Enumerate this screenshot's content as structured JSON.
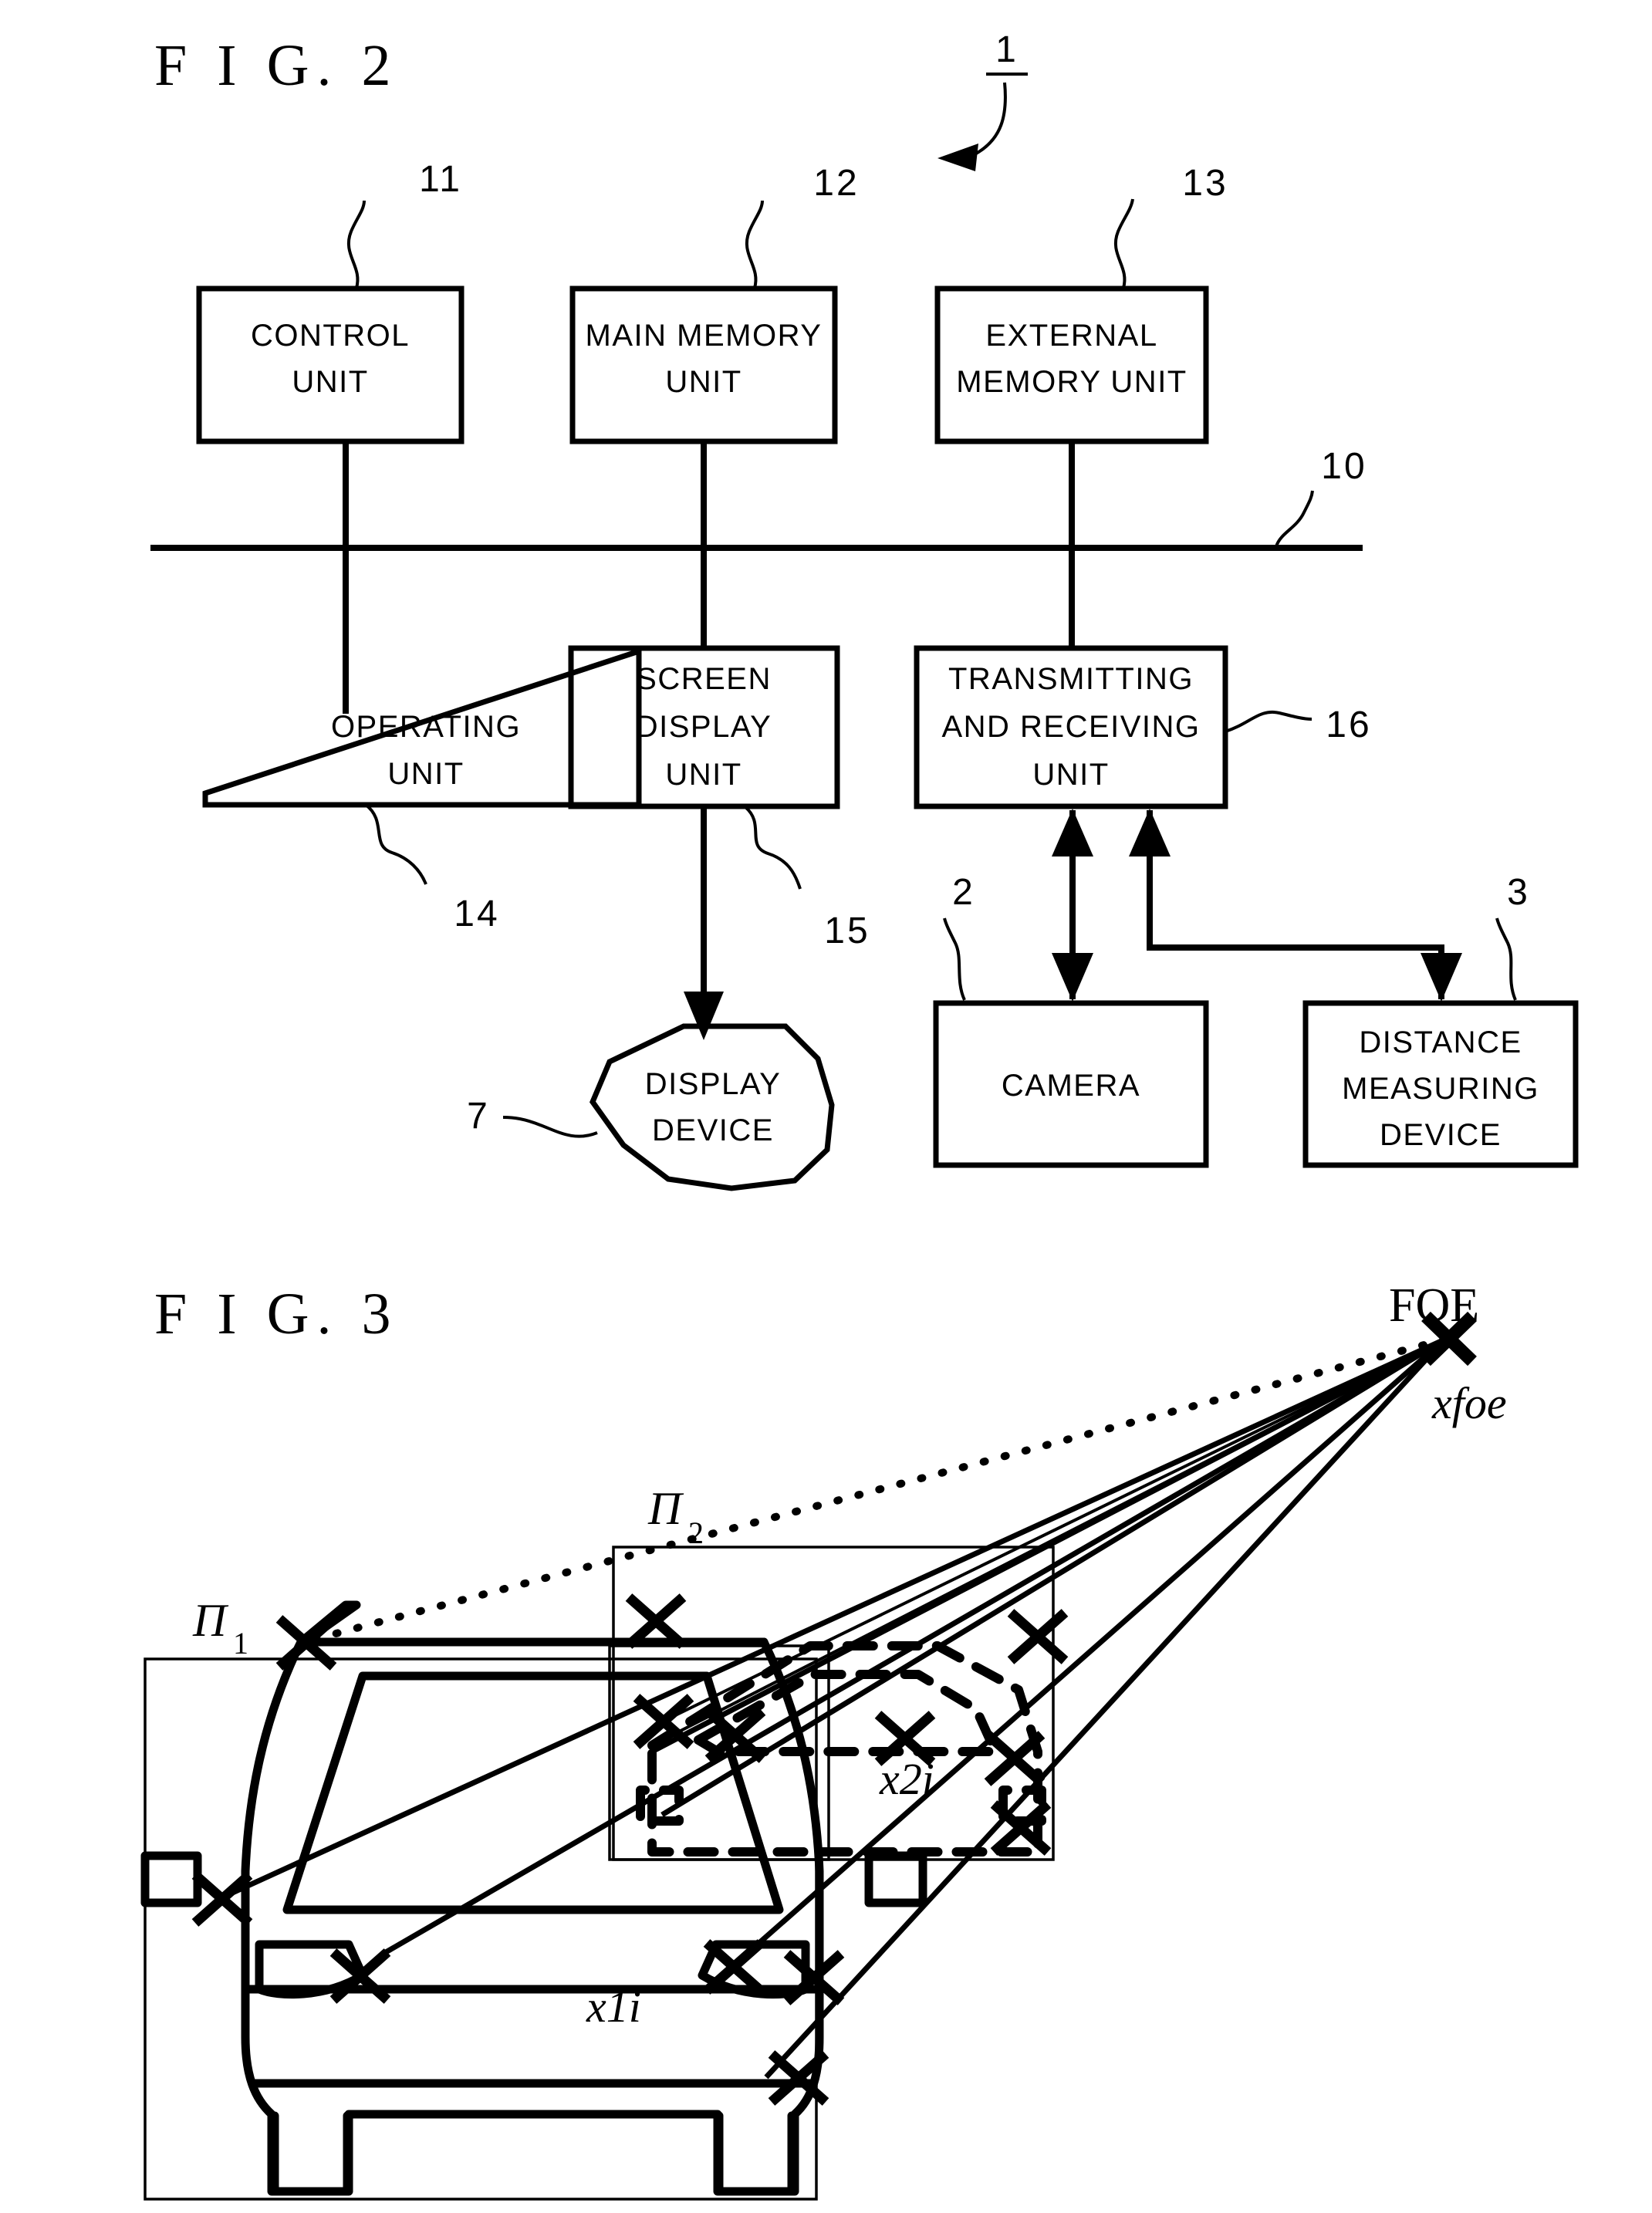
{
  "figures": [
    {
      "title": "F I G. 2",
      "system_ref": "1",
      "bus_ref": "10",
      "blocks": [
        {
          "id": "control-unit",
          "ref": "11",
          "lines": [
            "CONTROL",
            "UNIT"
          ]
        },
        {
          "id": "main-memory-unit",
          "ref": "12",
          "lines": [
            "MAIN MEMORY",
            "UNIT"
          ]
        },
        {
          "id": "external-memory-unit",
          "ref": "13",
          "lines": [
            "EXTERNAL",
            "MEMORY UNIT"
          ]
        },
        {
          "id": "operating-unit",
          "ref": "14",
          "lines": [
            "OPERATING",
            "UNIT"
          ]
        },
        {
          "id": "screen-display-unit",
          "ref": "15",
          "lines": [
            "SCREEN",
            "DISPLAY",
            "UNIT"
          ]
        },
        {
          "id": "transmitting-and-receiving-unit",
          "ref": "16",
          "lines": [
            "TRANSMITTING",
            "AND RECEIVING",
            "UNIT"
          ]
        },
        {
          "id": "display-device",
          "ref": "7",
          "lines": [
            "DISPLAY",
            "DEVICE"
          ]
        },
        {
          "id": "camera",
          "ref": "2",
          "lines": [
            "CAMERA"
          ]
        },
        {
          "id": "distance-measuring-device",
          "ref": "3",
          "lines": [
            "DISTANCE",
            "MEASURING",
            "DEVICE"
          ]
        }
      ]
    },
    {
      "title": "F I G. 3",
      "labels": {
        "foe": "FOE",
        "xfoe": "xfoe",
        "pi1_base": "Π",
        "pi1_sub": "1",
        "pi2_base": "Π",
        "pi2_sub": "2",
        "x1i": "x1i",
        "x2i": "x2i"
      }
    }
  ],
  "colors": {
    "ink": "#000000",
    "paper": "#ffffff"
  }
}
